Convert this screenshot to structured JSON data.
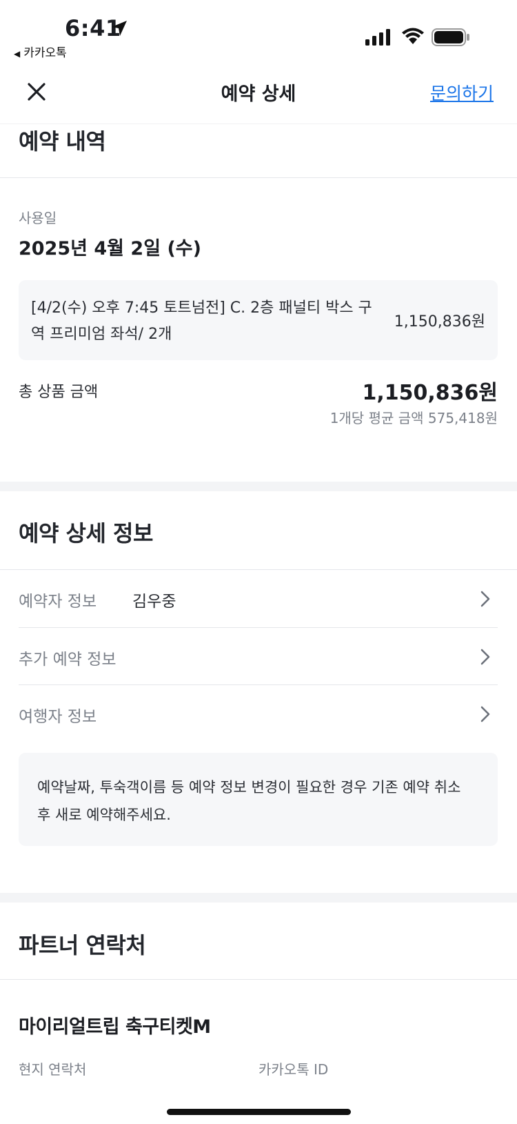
{
  "status_bar": {
    "time": "6:41",
    "back_app": "카카오톡"
  },
  "header": {
    "title": "예약 상세",
    "inquiry_link": "문의하기"
  },
  "reservation_history": {
    "title": "예약 내역",
    "use_date_label": "사용일",
    "use_date": "2025년 4월 2일 (수)",
    "product_name": "[4/2(수) 오후 7:45 토트넘전] C. 2층 패널티 박스 구역 프리미엄 좌석/ 2개",
    "product_price": "1,150,836원",
    "total_label": "총 상품 금액",
    "total_value": "1,150,836원",
    "avg_price": "1개당 평균 금액 575,418원"
  },
  "reservation_detail": {
    "title": "예약 상세 정보",
    "rows": [
      {
        "label": "예약자 정보",
        "value": "김우중"
      },
      {
        "label": "추가 예약 정보",
        "value": ""
      },
      {
        "label": "여행자 정보",
        "value": ""
      }
    ],
    "notice": "예약날짜, 투숙객이름 등 예약 정보 변경이 필요한 경우 기존 예약 취소 후 새로 예약해주세요."
  },
  "partner_contact": {
    "title": "파트너 연락처",
    "partner_name": "마이리얼트립 축구티켓M",
    "local_contact_label": "현지 연락처",
    "kakao_id_label": "카카오톡 ID"
  },
  "colors": {
    "link": "#1a74e8",
    "text_primary": "#1b1d22",
    "text_secondary": "#7b8089",
    "card_bg": "#f6f7f9"
  }
}
